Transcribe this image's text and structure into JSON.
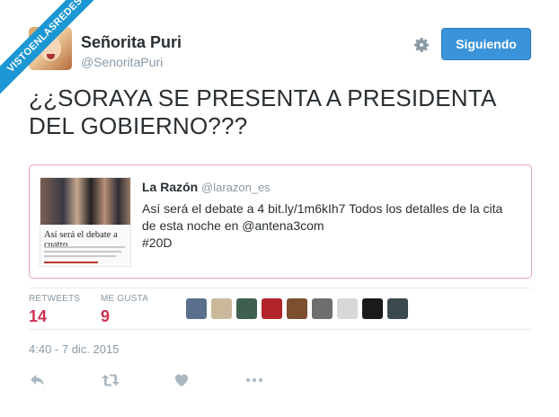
{
  "watermark": {
    "text": "VISTOENLASREDES"
  },
  "author": {
    "name": "Señorita Puri",
    "handle": "@SenoritaPuri",
    "follow_label": "Siguiendo"
  },
  "tweet": {
    "text": "¿¿SORAYA SE PRESENTA A PRESIDENTA DEL GOBIERNO???",
    "timestamp": "4:40 - 7 dic. 2015"
  },
  "quoted": {
    "name": "La Razón",
    "handle": "@larazon_es",
    "text": "Así será el debate a 4  bit.ly/1m6kIh7 Todos los detalles de la cita de esta noche en @antena3com",
    "hashtag": "#20D",
    "thumb_title": "Así será el debate a cuatro"
  },
  "stats": {
    "retweets_label": "RETWEETS",
    "retweets": "14",
    "likes_label": "ME GUSTA",
    "likes": "9"
  },
  "likers": [
    {
      "name": "liker-1-avatar",
      "color": "#5a6f8c"
    },
    {
      "name": "liker-2-avatar",
      "color": "#c9b89a"
    },
    {
      "name": "liker-3-avatar",
      "color": "#3f5f4f"
    },
    {
      "name": "liker-4-avatar",
      "color": "#b3242a"
    },
    {
      "name": "liker-5-avatar",
      "color": "#7b4f2f"
    },
    {
      "name": "liker-6-avatar",
      "color": "#6e6e6e"
    },
    {
      "name": "liker-7-avatar",
      "color": "#d8d8d8"
    },
    {
      "name": "liker-8-avatar",
      "color": "#1a1a1a"
    },
    {
      "name": "liker-9-avatar",
      "color": "#3a4a4f"
    }
  ],
  "actions": [
    "reply-icon",
    "retweet-icon",
    "like-icon",
    "more-icon"
  ],
  "colors": {
    "accent": "#3b94d9",
    "stat_value": "#cf3250",
    "quote_border": "#e1a5b0",
    "muted": "#8899a6"
  }
}
